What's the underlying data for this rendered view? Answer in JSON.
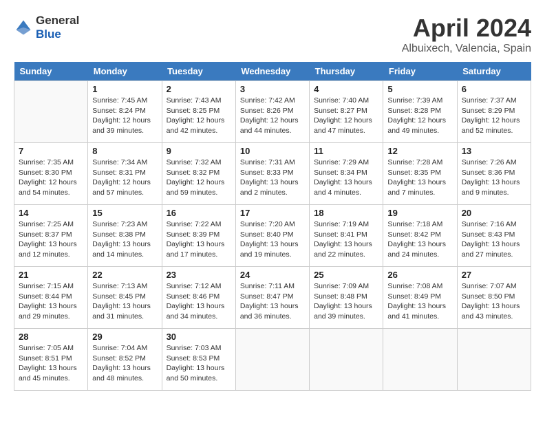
{
  "header": {
    "logo_line1": "General",
    "logo_line2": "Blue",
    "month_title": "April 2024",
    "location": "Albuixech, Valencia, Spain"
  },
  "weekdays": [
    "Sunday",
    "Monday",
    "Tuesday",
    "Wednesday",
    "Thursday",
    "Friday",
    "Saturday"
  ],
  "weeks": [
    [
      {
        "day": "",
        "sunrise": "",
        "sunset": "",
        "daylight": ""
      },
      {
        "day": "1",
        "sunrise": "Sunrise: 7:45 AM",
        "sunset": "Sunset: 8:24 PM",
        "daylight": "Daylight: 12 hours and 39 minutes."
      },
      {
        "day": "2",
        "sunrise": "Sunrise: 7:43 AM",
        "sunset": "Sunset: 8:25 PM",
        "daylight": "Daylight: 12 hours and 42 minutes."
      },
      {
        "day": "3",
        "sunrise": "Sunrise: 7:42 AM",
        "sunset": "Sunset: 8:26 PM",
        "daylight": "Daylight: 12 hours and 44 minutes."
      },
      {
        "day": "4",
        "sunrise": "Sunrise: 7:40 AM",
        "sunset": "Sunset: 8:27 PM",
        "daylight": "Daylight: 12 hours and 47 minutes."
      },
      {
        "day": "5",
        "sunrise": "Sunrise: 7:39 AM",
        "sunset": "Sunset: 8:28 PM",
        "daylight": "Daylight: 12 hours and 49 minutes."
      },
      {
        "day": "6",
        "sunrise": "Sunrise: 7:37 AM",
        "sunset": "Sunset: 8:29 PM",
        "daylight": "Daylight: 12 hours and 52 minutes."
      }
    ],
    [
      {
        "day": "7",
        "sunrise": "Sunrise: 7:35 AM",
        "sunset": "Sunset: 8:30 PM",
        "daylight": "Daylight: 12 hours and 54 minutes."
      },
      {
        "day": "8",
        "sunrise": "Sunrise: 7:34 AM",
        "sunset": "Sunset: 8:31 PM",
        "daylight": "Daylight: 12 hours and 57 minutes."
      },
      {
        "day": "9",
        "sunrise": "Sunrise: 7:32 AM",
        "sunset": "Sunset: 8:32 PM",
        "daylight": "Daylight: 12 hours and 59 minutes."
      },
      {
        "day": "10",
        "sunrise": "Sunrise: 7:31 AM",
        "sunset": "Sunset: 8:33 PM",
        "daylight": "Daylight: 13 hours and 2 minutes."
      },
      {
        "day": "11",
        "sunrise": "Sunrise: 7:29 AM",
        "sunset": "Sunset: 8:34 PM",
        "daylight": "Daylight: 13 hours and 4 minutes."
      },
      {
        "day": "12",
        "sunrise": "Sunrise: 7:28 AM",
        "sunset": "Sunset: 8:35 PM",
        "daylight": "Daylight: 13 hours and 7 minutes."
      },
      {
        "day": "13",
        "sunrise": "Sunrise: 7:26 AM",
        "sunset": "Sunset: 8:36 PM",
        "daylight": "Daylight: 13 hours and 9 minutes."
      }
    ],
    [
      {
        "day": "14",
        "sunrise": "Sunrise: 7:25 AM",
        "sunset": "Sunset: 8:37 PM",
        "daylight": "Daylight: 13 hours and 12 minutes."
      },
      {
        "day": "15",
        "sunrise": "Sunrise: 7:23 AM",
        "sunset": "Sunset: 8:38 PM",
        "daylight": "Daylight: 13 hours and 14 minutes."
      },
      {
        "day": "16",
        "sunrise": "Sunrise: 7:22 AM",
        "sunset": "Sunset: 8:39 PM",
        "daylight": "Daylight: 13 hours and 17 minutes."
      },
      {
        "day": "17",
        "sunrise": "Sunrise: 7:20 AM",
        "sunset": "Sunset: 8:40 PM",
        "daylight": "Daylight: 13 hours and 19 minutes."
      },
      {
        "day": "18",
        "sunrise": "Sunrise: 7:19 AM",
        "sunset": "Sunset: 8:41 PM",
        "daylight": "Daylight: 13 hours and 22 minutes."
      },
      {
        "day": "19",
        "sunrise": "Sunrise: 7:18 AM",
        "sunset": "Sunset: 8:42 PM",
        "daylight": "Daylight: 13 hours and 24 minutes."
      },
      {
        "day": "20",
        "sunrise": "Sunrise: 7:16 AM",
        "sunset": "Sunset: 8:43 PM",
        "daylight": "Daylight: 13 hours and 27 minutes."
      }
    ],
    [
      {
        "day": "21",
        "sunrise": "Sunrise: 7:15 AM",
        "sunset": "Sunset: 8:44 PM",
        "daylight": "Daylight: 13 hours and 29 minutes."
      },
      {
        "day": "22",
        "sunrise": "Sunrise: 7:13 AM",
        "sunset": "Sunset: 8:45 PM",
        "daylight": "Daylight: 13 hours and 31 minutes."
      },
      {
        "day": "23",
        "sunrise": "Sunrise: 7:12 AM",
        "sunset": "Sunset: 8:46 PM",
        "daylight": "Daylight: 13 hours and 34 minutes."
      },
      {
        "day": "24",
        "sunrise": "Sunrise: 7:11 AM",
        "sunset": "Sunset: 8:47 PM",
        "daylight": "Daylight: 13 hours and 36 minutes."
      },
      {
        "day": "25",
        "sunrise": "Sunrise: 7:09 AM",
        "sunset": "Sunset: 8:48 PM",
        "daylight": "Daylight: 13 hours and 39 minutes."
      },
      {
        "day": "26",
        "sunrise": "Sunrise: 7:08 AM",
        "sunset": "Sunset: 8:49 PM",
        "daylight": "Daylight: 13 hours and 41 minutes."
      },
      {
        "day": "27",
        "sunrise": "Sunrise: 7:07 AM",
        "sunset": "Sunset: 8:50 PM",
        "daylight": "Daylight: 13 hours and 43 minutes."
      }
    ],
    [
      {
        "day": "28",
        "sunrise": "Sunrise: 7:05 AM",
        "sunset": "Sunset: 8:51 PM",
        "daylight": "Daylight: 13 hours and 45 minutes."
      },
      {
        "day": "29",
        "sunrise": "Sunrise: 7:04 AM",
        "sunset": "Sunset: 8:52 PM",
        "daylight": "Daylight: 13 hours and 48 minutes."
      },
      {
        "day": "30",
        "sunrise": "Sunrise: 7:03 AM",
        "sunset": "Sunset: 8:53 PM",
        "daylight": "Daylight: 13 hours and 50 minutes."
      },
      {
        "day": "",
        "sunrise": "",
        "sunset": "",
        "daylight": ""
      },
      {
        "day": "",
        "sunrise": "",
        "sunset": "",
        "daylight": ""
      },
      {
        "day": "",
        "sunrise": "",
        "sunset": "",
        "daylight": ""
      },
      {
        "day": "",
        "sunrise": "",
        "sunset": "",
        "daylight": ""
      }
    ]
  ]
}
